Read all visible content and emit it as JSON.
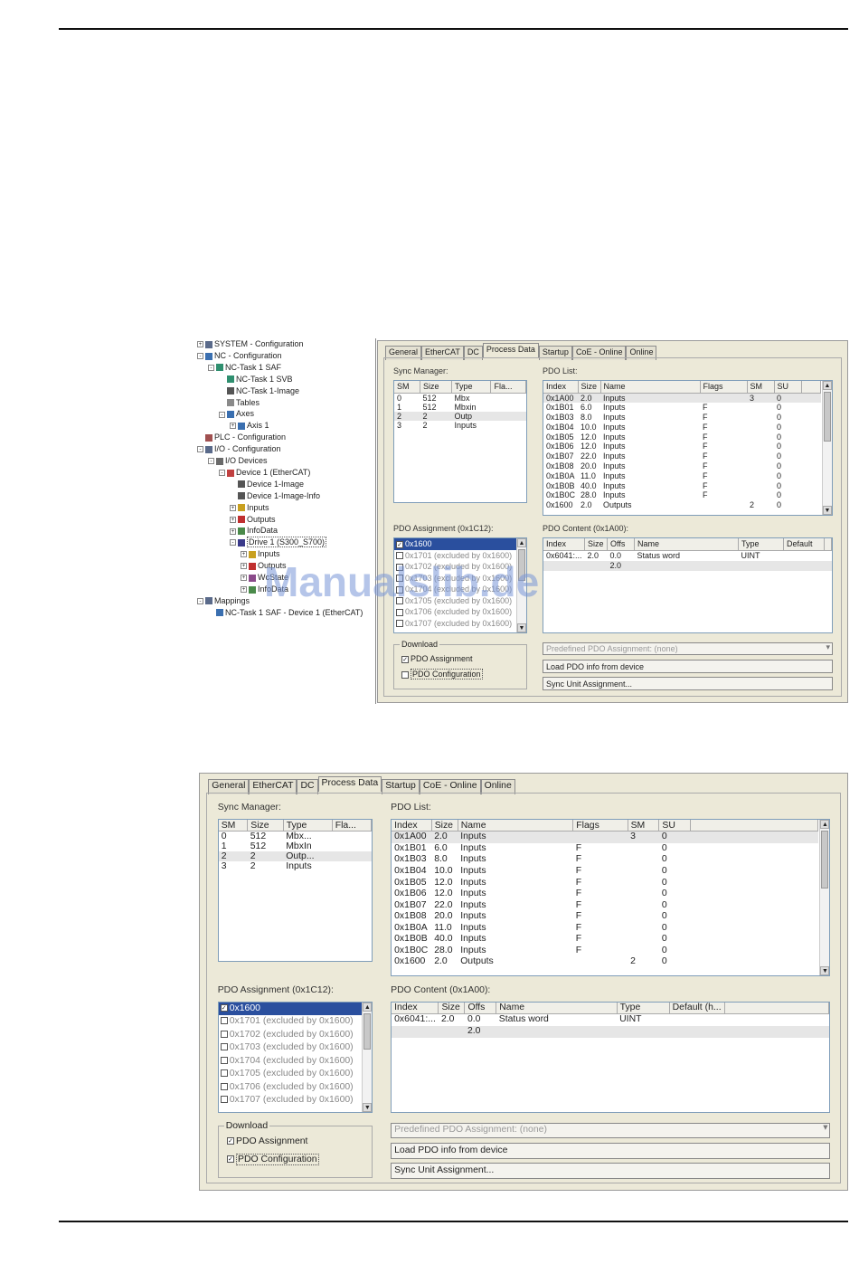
{
  "watermark": "Manualslib.de",
  "tree": [
    {
      "label": "SYSTEM - Configuration",
      "level": 0,
      "toggle": "+",
      "icon": "system-icon"
    },
    {
      "label": "NC - Configuration",
      "level": 0,
      "toggle": "-",
      "icon": "nc-icon"
    },
    {
      "label": "NC-Task 1 SAF",
      "level": 1,
      "toggle": "-",
      "icon": "task-icon"
    },
    {
      "label": "NC-Task 1 SVB",
      "level": 2,
      "toggle": "",
      "icon": "task-icon"
    },
    {
      "label": "NC-Task 1-Image",
      "level": 2,
      "toggle": "",
      "icon": "image-icon"
    },
    {
      "label": "Tables",
      "level": 2,
      "toggle": "",
      "icon": "table-icon"
    },
    {
      "label": "Axes",
      "level": 2,
      "toggle": "-",
      "icon": "axes-icon"
    },
    {
      "label": "Axis 1",
      "level": 3,
      "toggle": "+",
      "icon": "axis-icon"
    },
    {
      "label": "PLC - Configuration",
      "level": 0,
      "toggle": "",
      "icon": "plc-icon"
    },
    {
      "label": "I/O - Configuration",
      "level": 0,
      "toggle": "-",
      "icon": "io-icon"
    },
    {
      "label": "I/O Devices",
      "level": 1,
      "toggle": "-",
      "icon": "devices-icon"
    },
    {
      "label": "Device 1 (EtherCAT)",
      "level": 2,
      "toggle": "-",
      "icon": "ethercat-icon"
    },
    {
      "label": "Device 1-Image",
      "level": 3,
      "toggle": "",
      "icon": "image-icon"
    },
    {
      "label": "Device 1-Image-Info",
      "level": 3,
      "toggle": "",
      "icon": "image-icon"
    },
    {
      "label": "Inputs",
      "level": 3,
      "toggle": "+",
      "icon": "inputs-icon"
    },
    {
      "label": "Outputs",
      "level": 3,
      "toggle": "+",
      "icon": "outputs-icon"
    },
    {
      "label": "InfoData",
      "level": 3,
      "toggle": "+",
      "icon": "infodata-icon"
    },
    {
      "label": "Drive 1 (S300_S700)",
      "level": 3,
      "toggle": "-",
      "icon": "drive-icon",
      "selected": true
    },
    {
      "label": "Inputs",
      "level": 4,
      "toggle": "+",
      "icon": "inputs-icon"
    },
    {
      "label": "Outputs",
      "level": 4,
      "toggle": "+",
      "icon": "outputs-icon"
    },
    {
      "label": "WcState",
      "level": 4,
      "toggle": "+",
      "icon": "wcstate-icon"
    },
    {
      "label": "InfoData",
      "level": 4,
      "toggle": "+",
      "icon": "infodata-icon"
    },
    {
      "label": "Mappings",
      "level": 0,
      "toggle": "-",
      "icon": "mappings-icon"
    },
    {
      "label": "NC-Task 1 SAF - Device 1 (EtherCAT)",
      "level": 1,
      "toggle": "",
      "icon": "mapping-icon"
    }
  ],
  "dialog": {
    "tabs": [
      "General",
      "EtherCAT",
      "DC",
      "Process Data",
      "Startup",
      "CoE - Online",
      "Online"
    ],
    "active_tab": "Process Data",
    "sync_manager": {
      "label": "Sync Manager:",
      "columns": [
        "SM",
        "Size",
        "Type",
        "Fla..."
      ],
      "rows_small": [
        [
          "0",
          "512",
          "Mbx",
          ""
        ],
        [
          "1",
          "512",
          "Mbxin",
          ""
        ],
        [
          "2",
          "2",
          "Outp",
          ""
        ],
        [
          "3",
          "2",
          "Inputs",
          ""
        ]
      ],
      "rows_large": [
        [
          "0",
          "512",
          "Mbx...",
          ""
        ],
        [
          "1",
          "512",
          "MbxIn",
          ""
        ],
        [
          "2",
          "2",
          "Outp...",
          ""
        ],
        [
          "3",
          "2",
          "Inputs",
          ""
        ]
      ]
    },
    "pdo_list": {
      "label": "PDO List:",
      "columns": [
        "Index",
        "Size",
        "Name",
        "Flags",
        "SM",
        "SU"
      ],
      "rows": [
        [
          "0x1A00",
          "2.0",
          "Inputs",
          "",
          "3",
          "0"
        ],
        [
          "0x1B01",
          "6.0",
          "Inputs",
          "F",
          "",
          "0"
        ],
        [
          "0x1B03",
          "8.0",
          "Inputs",
          "F",
          "",
          "0"
        ],
        [
          "0x1B04",
          "10.0",
          "Inputs",
          "F",
          "",
          "0"
        ],
        [
          "0x1B05",
          "12.0",
          "Inputs",
          "F",
          "",
          "0"
        ],
        [
          "0x1B06",
          "12.0",
          "Inputs",
          "F",
          "",
          "0"
        ],
        [
          "0x1B07",
          "22.0",
          "Inputs",
          "F",
          "",
          "0"
        ],
        [
          "0x1B08",
          "20.0",
          "Inputs",
          "F",
          "",
          "0"
        ],
        [
          "0x1B0A",
          "11.0",
          "Inputs",
          "F",
          "",
          "0"
        ],
        [
          "0x1B0B",
          "40.0",
          "Inputs",
          "F",
          "",
          "0"
        ],
        [
          "0x1B0C",
          "28.0",
          "Inputs",
          "F",
          "",
          "0"
        ],
        [
          "0x1600",
          "2.0",
          "Outputs",
          "",
          "2",
          "0"
        ]
      ]
    },
    "pdo_assignment": {
      "label": "PDO Assignment (0x1C12):",
      "items": [
        {
          "label": "0x1600",
          "checked": true
        },
        {
          "label": "0x1701 (excluded by 0x1600)",
          "checked": false
        },
        {
          "label": "0x1702 (excluded by 0x1600)",
          "checked": false
        },
        {
          "label": "0x1703 (excluded by 0x1600)",
          "checked": false
        },
        {
          "label": "0x1704 (excluded by 0x1600)",
          "checked": false
        },
        {
          "label": "0x1705 (excluded by 0x1600)",
          "checked": false
        },
        {
          "label": "0x1706 (excluded by 0x1600)",
          "checked": false
        },
        {
          "label": "0x1707 (excluded by 0x1600)",
          "checked": false
        }
      ]
    },
    "pdo_content": {
      "label": "PDO Content (0x1A00):",
      "columns_small": [
        "Index",
        "Size",
        "Offs",
        "Name",
        "Type",
        "Default"
      ],
      "columns_large": [
        "Index",
        "Size",
        "Offs",
        "Name",
        "Type",
        "Default (h..."
      ],
      "rows": [
        [
          "0x6041:...",
          "2.0",
          "0.0",
          "Status word",
          "UINT",
          ""
        ],
        [
          "",
          "",
          "2.0",
          "",
          "",
          ""
        ]
      ]
    },
    "download": {
      "label": "Download",
      "pdo_assignment": "PDO Assignment",
      "pdo_configuration": "PDO Configuration"
    },
    "predefined": "Predefined PDO Assignment: (none)",
    "load_button": "Load PDO info from device",
    "sync_button": "Sync Unit Assignment..."
  }
}
